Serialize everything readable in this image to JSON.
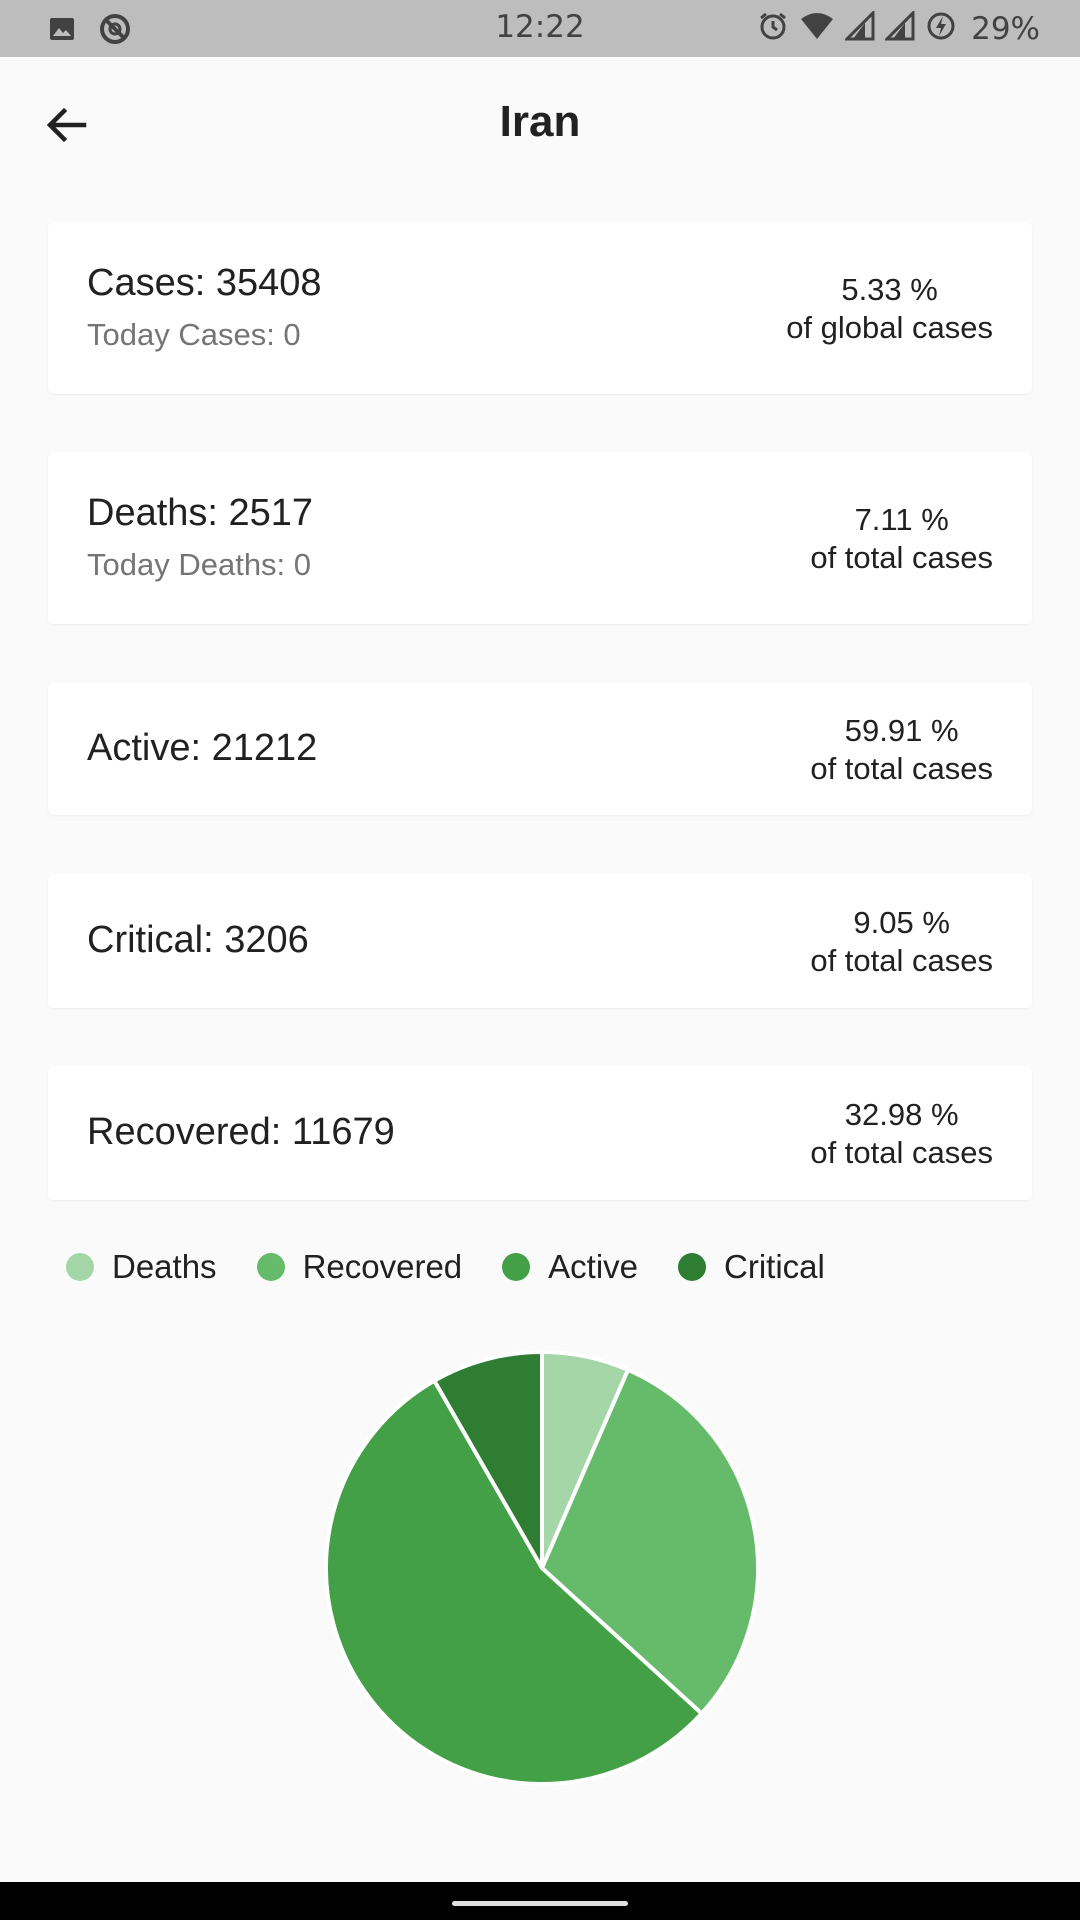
{
  "status_bar": {
    "time": "12:22",
    "battery": "29%",
    "left_icons": [
      "image-icon",
      "sync-icon"
    ],
    "right_icons": [
      "alarm-icon",
      "wifi-icon",
      "signal-icon",
      "signal-icon",
      "battery-charging-icon"
    ]
  },
  "header": {
    "title": "Iran",
    "back_icon": "arrow-left-icon"
  },
  "cards": {
    "cases": {
      "main": "Cases: 35408",
      "sub": "Today Cases: 0",
      "pct": "5.33 %",
      "pct_label": "of global cases"
    },
    "deaths": {
      "main": "Deaths: 2517",
      "sub": "Today Deaths: 0",
      "pct": "7.11 %",
      "pct_label": "of total cases"
    },
    "active": {
      "main": "Active: 21212",
      "pct": "59.91 %",
      "pct_label": "of total cases"
    },
    "critical": {
      "main": "Critical: 3206",
      "pct": "9.05 %",
      "pct_label": "of total cases"
    },
    "recovered": {
      "main": "Recovered: 11679",
      "pct": "32.98 %",
      "pct_label": "of total cases"
    }
  },
  "legend": [
    {
      "label": "Deaths",
      "color": "#a5d6a7"
    },
    {
      "label": "Recovered",
      "color": "#66bb6a"
    },
    {
      "label": "Active",
      "color": "#43a047"
    },
    {
      "label": "Critical",
      "color": "#2e7d32"
    }
  ],
  "chart_data": {
    "type": "pie",
    "categories": [
      "Deaths",
      "Recovered",
      "Active",
      "Critical"
    ],
    "values": [
      2517,
      11679,
      21212,
      3206
    ],
    "colors": [
      "#a5d6a7",
      "#66bb6a",
      "#43a047",
      "#2e7d32"
    ]
  }
}
